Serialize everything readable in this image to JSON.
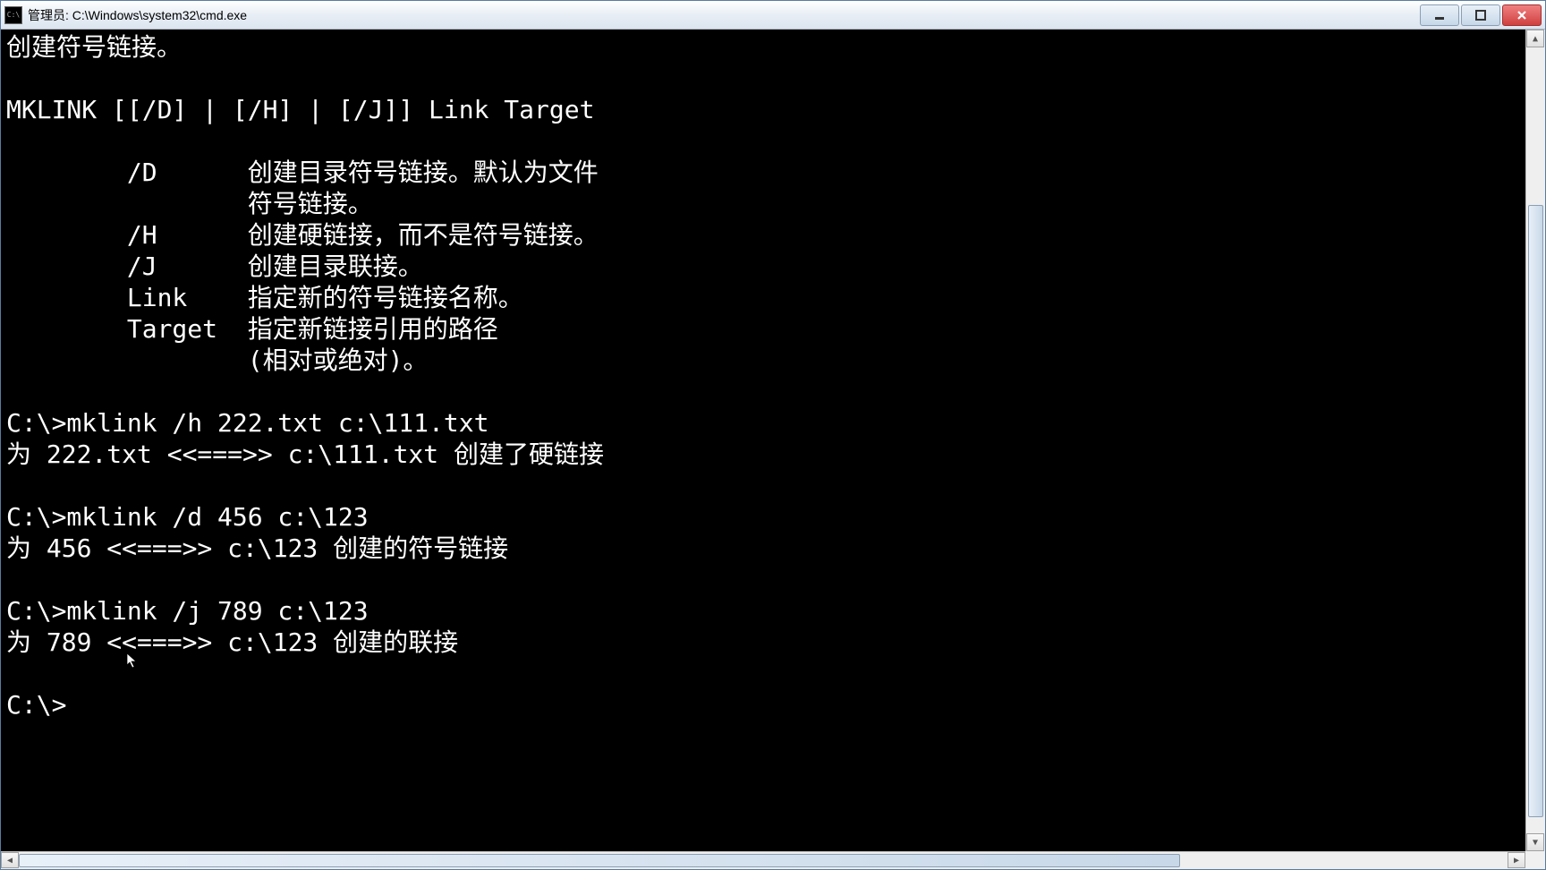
{
  "titlebar": {
    "icon_label": "cmd",
    "title": "管理员: C:\\Windows\\system32\\cmd.exe"
  },
  "window_controls": {
    "minimize": "minimize",
    "maximize": "maximize",
    "close": "close"
  },
  "terminal": {
    "lines": [
      "创建符号链接。",
      "",
      "MKLINK [[/D] | [/H] | [/J]] Link Target",
      "",
      "        /D      创建目录符号链接。默认为文件",
      "                符号链接。",
      "        /H      创建硬链接，而不是符号链接。",
      "        /J      创建目录联接。",
      "        Link    指定新的符号链接名称。",
      "        Target  指定新链接引用的路径",
      "                (相对或绝对)。",
      "",
      "C:\\>mklink /h 222.txt c:\\111.txt",
      "为 222.txt <<===>> c:\\111.txt 创建了硬链接",
      "",
      "C:\\>mklink /d 456 c:\\123",
      "为 456 <<===>> c:\\123 创建的符号链接",
      "",
      "C:\\>mklink /j 789 c:\\123",
      "为 789 <<===>> c:\\123 创建的联接",
      "",
      "C:\\>"
    ]
  },
  "scrollbar": {
    "up": "▲",
    "down": "▼",
    "left": "◀",
    "right": "▶"
  }
}
